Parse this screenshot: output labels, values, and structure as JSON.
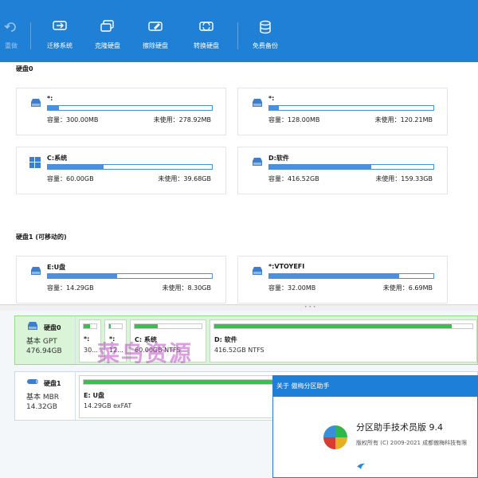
{
  "toolbar": {
    "buttons": [
      {
        "label": "重做",
        "icon": "redo-icon",
        "enabled": false
      },
      {
        "label": "迁移系统",
        "icon": "migrate-system-icon",
        "enabled": true
      },
      {
        "label": "克隆硬盘",
        "icon": "clone-disk-icon",
        "enabled": true
      },
      {
        "label": "擦除硬盘",
        "icon": "wipe-disk-icon",
        "enabled": true
      },
      {
        "label": "转换硬盘",
        "icon": "convert-disk-icon",
        "enabled": true
      },
      {
        "label": "免费备份",
        "icon": "backup-icon",
        "enabled": true
      }
    ]
  },
  "disk0": {
    "title": "硬盘0",
    "cards": [
      {
        "name": "*:",
        "capacity": "容量：300.00MB",
        "free": "未使用：278.92MB",
        "used_fraction": 0.07,
        "icon": "drive-icon"
      },
      {
        "name": "*:",
        "capacity": "容量：128.00MB",
        "free": "未使用：120.21MB",
        "used_fraction": 0.06,
        "icon": "drive-icon"
      },
      {
        "name": "C:系统",
        "capacity": "容量：60.00GB",
        "free": "未使用：39.68GB",
        "used_fraction": 0.34,
        "icon": "windows-icon"
      },
      {
        "name": "D:软件",
        "capacity": "容量：416.52GB",
        "free": "未使用：159.33GB",
        "used_fraction": 0.62,
        "icon": "drive-icon"
      }
    ]
  },
  "disk1": {
    "title": "硬盘1 (可移动的)",
    "cards": [
      {
        "name": "E:U盘",
        "capacity": "容量：14.29GB",
        "free": "未使用：8.30GB",
        "used_fraction": 0.42,
        "icon": "drive-icon"
      },
      {
        "name": "*:VTOYEFI",
        "capacity": "容量：32.00MB",
        "free": "未使用：6.69MB",
        "used_fraction": 0.79,
        "icon": "drive-icon"
      }
    ]
  },
  "map": {
    "disk0": {
      "name": "硬盘0",
      "type": "基本 GPT",
      "size": "476.94GB",
      "partitions": [
        {
          "name": "*:",
          "info": "30...",
          "used_fraction": 0.5
        },
        {
          "name": "*:",
          "info": "12...",
          "used_fraction": 0.1
        },
        {
          "name": "C: 系统",
          "info": "60.00GB NTFS",
          "used_fraction": 0.34
        },
        {
          "name": "D: 软件",
          "info": "416.52GB NTFS",
          "used_fraction": 0.92
        }
      ]
    },
    "disk1": {
      "name": "硬盘1",
      "type": "基本 MBR",
      "size": "14.32GB",
      "partitions": [
        {
          "name": "E: U盘",
          "info": "14.29GB exFAT",
          "used_fraction": 0.98
        }
      ]
    }
  },
  "watermark": "菜鸟资源",
  "about": {
    "title": "关于 傲梅分区助手",
    "product": "分区助手技术员版 9.4",
    "copyright": "版权所有 (C) 2009-2021 成都傲梅科技有限"
  },
  "colors": {
    "toolbar": "#1f80d6",
    "bar_blue": "#4a90e2",
    "bar_green": "#33c24a",
    "selected_row": "#d9f4d6"
  }
}
